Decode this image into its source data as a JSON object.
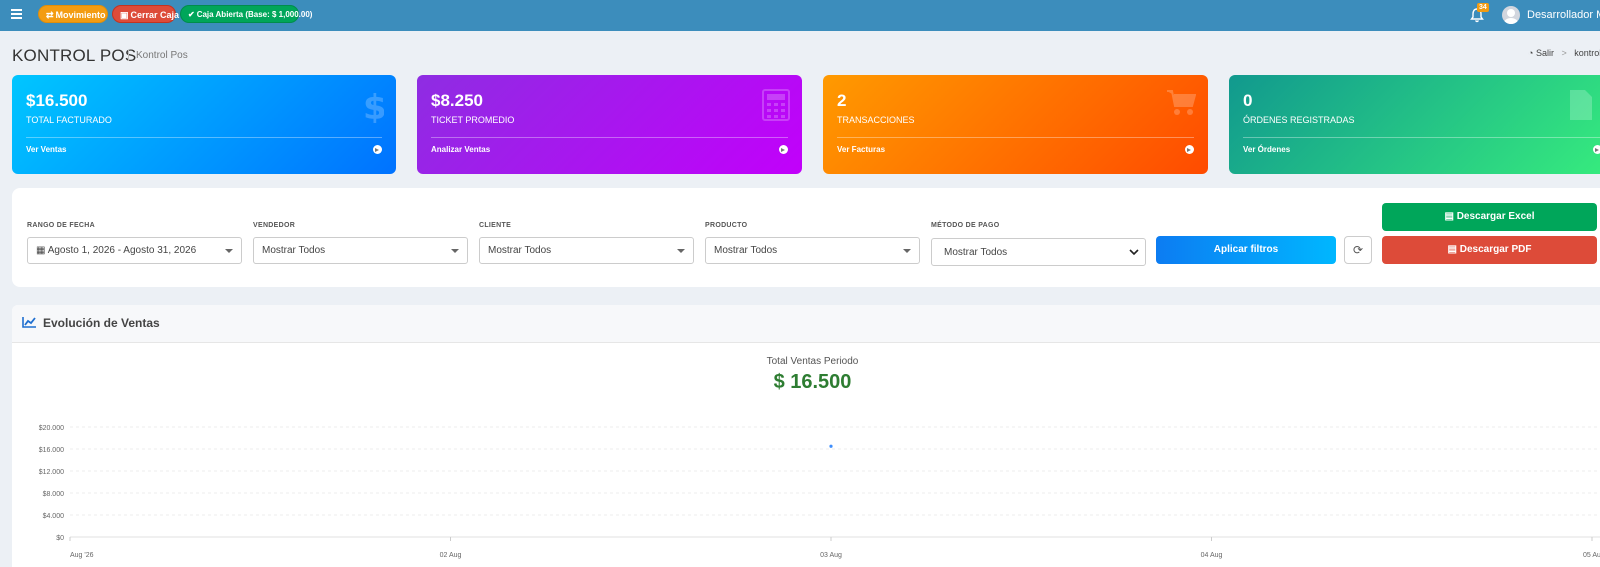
{
  "navbar": {
    "movimiento_label": "Movimiento",
    "cerrar_caja_label": "Cerrar Caja",
    "caja_status_label": "Caja Abierta (Base: $ 1,000.00)",
    "notification_count": "34",
    "username": "Desarrollador Mas"
  },
  "header": {
    "title": "KONTROL POS",
    "subtitle": "Kontrol Pos",
    "breadcrumb": [
      "Salir",
      "kontrol"
    ]
  },
  "stats": [
    {
      "value": "$16.500",
      "label": "TOTAL FACTURADO",
      "link": "Ver Ventas",
      "icon": "dollar-icon"
    },
    {
      "value": "$8.250",
      "label": "TICKET PROMEDIO",
      "link": "Analizar Ventas",
      "icon": "calculator-icon"
    },
    {
      "value": "2",
      "label": "TRANSACCIONES",
      "link": "Ver Facturas",
      "icon": "cart-icon"
    },
    {
      "value": "0",
      "label": "ÓRDENES REGISTRADAS",
      "link": "Ver Órdenes",
      "icon": "document-icon"
    }
  ],
  "filters": {
    "date_range": {
      "label": "RANGO DE FECHA",
      "value": "Agosto 1, 2026 - Agosto 31, 2026"
    },
    "vendedor": {
      "label": "VENDEDOR",
      "value": "Mostrar Todos"
    },
    "cliente": {
      "label": "CLIENTE",
      "value": "Mostrar Todos"
    },
    "producto": {
      "label": "PRODUCTO",
      "value": "Mostrar Todos"
    },
    "metodo_pago": {
      "label": "MÉTODO DE PAGO",
      "value": "Mostrar Todos"
    },
    "apply_label": "Aplicar filtros",
    "excel_label": "Descargar Excel",
    "pdf_label": "Descargar PDF"
  },
  "chart_panel": {
    "title": "Evolución de Ventas",
    "total_label": "Total Ventas Periodo",
    "total_value": "$ 16.500"
  },
  "chart_data": {
    "type": "line",
    "title": "",
    "xlabel": "",
    "ylabel": "",
    "x_tick_labels": [
      "Aug '26",
      "02 Aug",
      "03 Aug",
      "04 Aug",
      "05 Au"
    ],
    "y_tick_labels": [
      "$0",
      "$4.000",
      "$8.000",
      "$12.000",
      "$16.000",
      "$20.000"
    ],
    "ylim": [
      0,
      20000
    ],
    "xlim": [
      0,
      4
    ],
    "grid": true,
    "series": [
      {
        "x": [
          2
        ],
        "y": [
          16500
        ],
        "color": "#3f8efc"
      }
    ]
  },
  "colors": {
    "navbar": "#3c8dbc",
    "movimiento": "#f39c12",
    "cerrar_caja": "#dd4b39",
    "caja_abierta": "#00a65a",
    "total_value": "#2e7d32"
  }
}
